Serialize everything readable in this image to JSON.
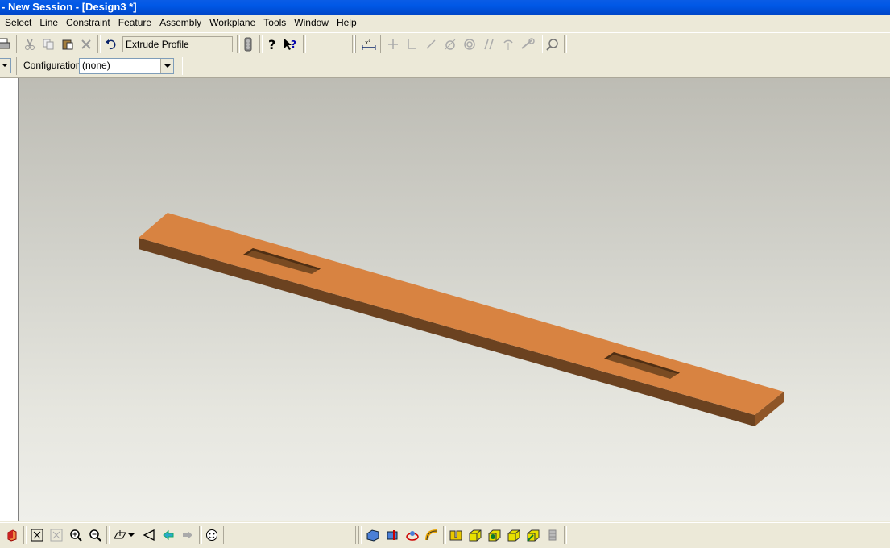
{
  "window": {
    "title": "- New Session - [Design3 *]"
  },
  "menu": [
    "Select",
    "Line",
    "Constraint",
    "Feature",
    "Assembly",
    "Workplane",
    "Tools",
    "Window",
    "Help"
  ],
  "toolbar": {
    "command_field": "Extrude Profile"
  },
  "config": {
    "label": "Configuration:",
    "value": "(none)"
  },
  "colors": {
    "part_top": "#d88341",
    "part_side": "#6b4220",
    "part_front": "#8e5527",
    "titlebar": "#0058e6"
  }
}
